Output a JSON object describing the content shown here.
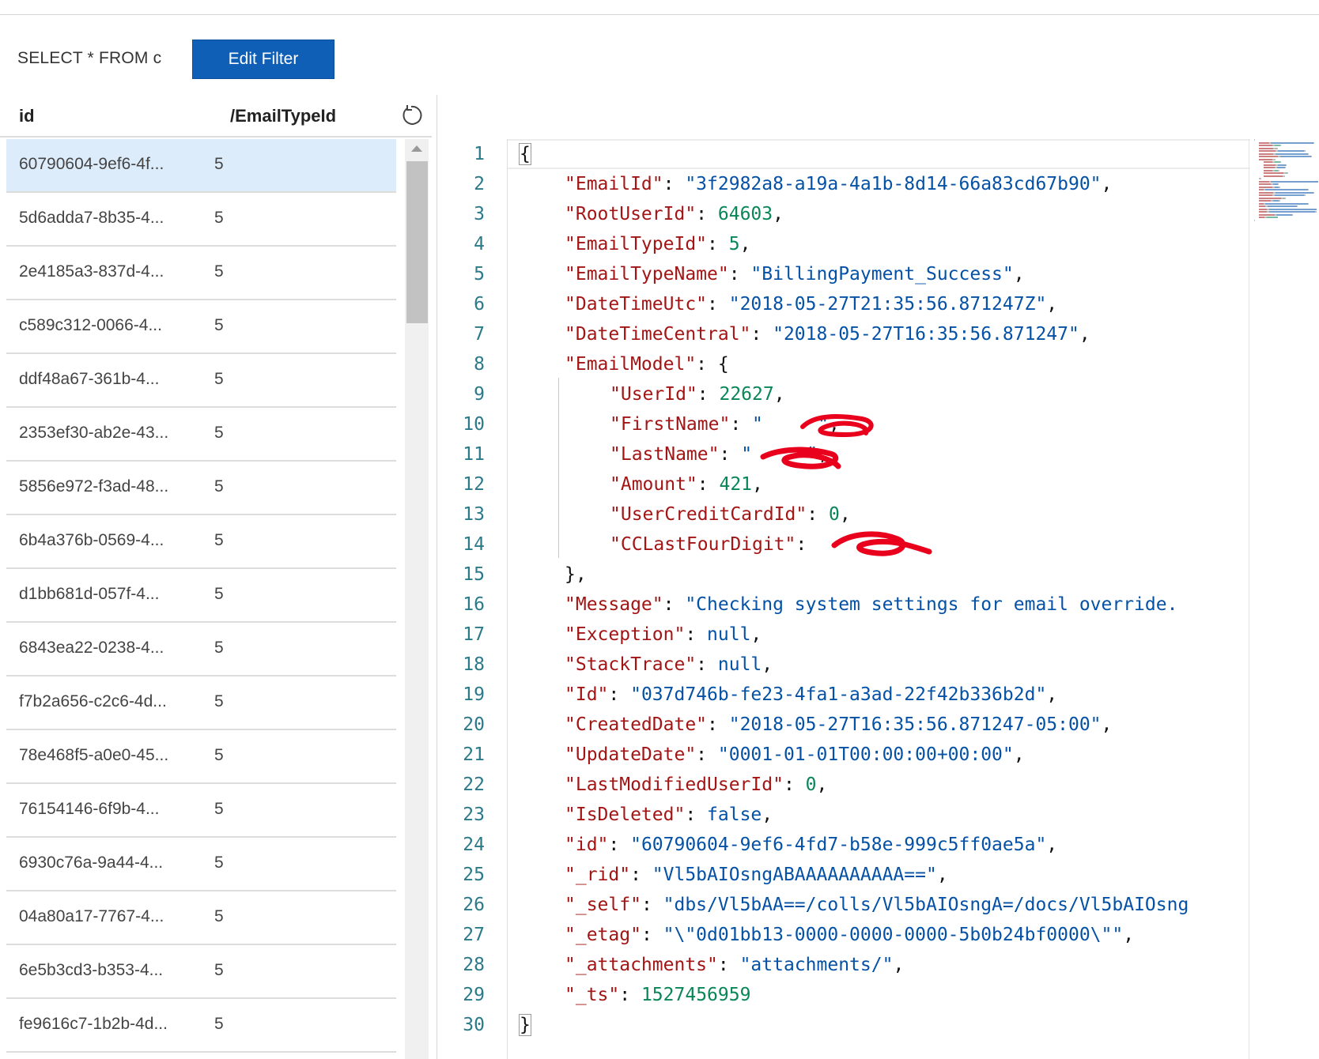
{
  "filter": {
    "query": "SELECT * FROM c",
    "edit_label": "Edit Filter"
  },
  "table": {
    "headers": {
      "id": "id",
      "partition": "/EmailTypeId"
    },
    "rows": [
      {
        "id": "60790604-9ef6-4f...",
        "value": "5",
        "selected": true
      },
      {
        "id": "5d6adda7-8b35-4...",
        "value": "5"
      },
      {
        "id": "2e4185a3-837d-4...",
        "value": "5"
      },
      {
        "id": "c589c312-0066-4...",
        "value": "5"
      },
      {
        "id": "ddf48a67-361b-4...",
        "value": "5"
      },
      {
        "id": "2353ef30-ab2e-43...",
        "value": "5"
      },
      {
        "id": "5856e972-f3ad-48...",
        "value": "5"
      },
      {
        "id": "6b4a376b-0569-4...",
        "value": "5"
      },
      {
        "id": "d1bb681d-057f-4...",
        "value": "5"
      },
      {
        "id": "6843ea22-0238-4...",
        "value": "5"
      },
      {
        "id": "f7b2a656-c2c6-4d...",
        "value": "5"
      },
      {
        "id": "78e468f5-a0e0-45...",
        "value": "5"
      },
      {
        "id": "76154146-6f9b-4...",
        "value": "5"
      },
      {
        "id": "6930c76a-9a44-4...",
        "value": "5"
      },
      {
        "id": "04a80a17-7767-4...",
        "value": "5"
      },
      {
        "id": "6e5b3cd3-b353-4...",
        "value": "5"
      },
      {
        "id": "fe9616c7-1b2b-4d...",
        "value": "5"
      }
    ]
  },
  "icons": {
    "refresh": "refresh-icon",
    "scroll_up": "scroll-up-arrow-icon"
  },
  "colors": {
    "accent": "#0f5fb7",
    "selected_row": "#ddecfb",
    "json_key": "#a31515",
    "json_string": "#0451a5",
    "json_number": "#098658",
    "redaction": "#e8001c"
  },
  "editor": {
    "lines": [
      {
        "n": "1",
        "indent": 0,
        "parts": [
          [
            "p",
            "{"
          ]
        ]
      },
      {
        "n": "2",
        "indent": 1,
        "parts": [
          [
            "k",
            "\"EmailId\""
          ],
          [
            "p",
            ": "
          ],
          [
            "s",
            "\"3f2982a8-a19a-4a1b-8d14-66a83cd67b90\""
          ],
          [
            "p",
            ","
          ]
        ]
      },
      {
        "n": "3",
        "indent": 1,
        "parts": [
          [
            "k",
            "\"RootUserId\""
          ],
          [
            "p",
            ": "
          ],
          [
            "n",
            "64603"
          ],
          [
            "p",
            ","
          ]
        ]
      },
      {
        "n": "4",
        "indent": 1,
        "parts": [
          [
            "k",
            "\"EmailTypeId\""
          ],
          [
            "p",
            ": "
          ],
          [
            "n",
            "5"
          ],
          [
            "p",
            ","
          ]
        ]
      },
      {
        "n": "5",
        "indent": 1,
        "parts": [
          [
            "k",
            "\"EmailTypeName\""
          ],
          [
            "p",
            ": "
          ],
          [
            "s",
            "\"BillingPayment_Success\""
          ],
          [
            "p",
            ","
          ]
        ]
      },
      {
        "n": "6",
        "indent": 1,
        "parts": [
          [
            "k",
            "\"DateTimeUtc\""
          ],
          [
            "p",
            ": "
          ],
          [
            "s",
            "\"2018-05-27T21:35:56.871247Z\""
          ],
          [
            "p",
            ","
          ]
        ]
      },
      {
        "n": "7",
        "indent": 1,
        "parts": [
          [
            "k",
            "\"DateTimeCentral\""
          ],
          [
            "p",
            ": "
          ],
          [
            "s",
            "\"2018-05-27T16:35:56.871247\""
          ],
          [
            "p",
            ","
          ]
        ]
      },
      {
        "n": "8",
        "indent": 1,
        "parts": [
          [
            "k",
            "\"EmailModel\""
          ],
          [
            "p",
            ": {"
          ]
        ]
      },
      {
        "n": "9",
        "indent": 2,
        "parts": [
          [
            "k",
            "\"UserId\""
          ],
          [
            "p",
            ": "
          ],
          [
            "n",
            "22627"
          ],
          [
            "p",
            ","
          ]
        ]
      },
      {
        "n": "10",
        "indent": 2,
        "parts": [
          [
            "k",
            "\"FirstName\""
          ],
          [
            "p",
            ": "
          ],
          [
            "s",
            "\"     \""
          ],
          [
            "p",
            ","
          ]
        ]
      },
      {
        "n": "11",
        "indent": 2,
        "parts": [
          [
            "k",
            "\"LastName\""
          ],
          [
            "p",
            ": "
          ],
          [
            "s",
            "\"     \""
          ],
          [
            "p",
            ","
          ]
        ]
      },
      {
        "n": "12",
        "indent": 2,
        "parts": [
          [
            "k",
            "\"Amount\""
          ],
          [
            "p",
            ": "
          ],
          [
            "n",
            "421"
          ],
          [
            "p",
            ","
          ]
        ]
      },
      {
        "n": "13",
        "indent": 2,
        "parts": [
          [
            "k",
            "\"UserCreditCardId\""
          ],
          [
            "p",
            ": "
          ],
          [
            "n",
            "0"
          ],
          [
            "p",
            ","
          ]
        ]
      },
      {
        "n": "14",
        "indent": 2,
        "parts": [
          [
            "k",
            "\"CCLastFourDigit\""
          ],
          [
            "p",
            ": "
          ]
        ]
      },
      {
        "n": "15",
        "indent": 1,
        "parts": [
          [
            "p",
            "},"
          ]
        ]
      },
      {
        "n": "16",
        "indent": 1,
        "parts": [
          [
            "k",
            "\"Message\""
          ],
          [
            "p",
            ": "
          ],
          [
            "s",
            "\"Checking system settings for email override."
          ]
        ]
      },
      {
        "n": "17",
        "indent": 1,
        "parts": [
          [
            "k",
            "\"Exception\""
          ],
          [
            "p",
            ": "
          ],
          [
            "b",
            "null"
          ],
          [
            "p",
            ","
          ]
        ]
      },
      {
        "n": "18",
        "indent": 1,
        "parts": [
          [
            "k",
            "\"StackTrace\""
          ],
          [
            "p",
            ": "
          ],
          [
            "b",
            "null"
          ],
          [
            "p",
            ","
          ]
        ]
      },
      {
        "n": "19",
        "indent": 1,
        "parts": [
          [
            "k",
            "\"Id\""
          ],
          [
            "p",
            ": "
          ],
          [
            "s",
            "\"037d746b-fe23-4fa1-a3ad-22f42b336b2d\""
          ],
          [
            "p",
            ","
          ]
        ]
      },
      {
        "n": "20",
        "indent": 1,
        "parts": [
          [
            "k",
            "\"CreatedDate\""
          ],
          [
            "p",
            ": "
          ],
          [
            "s",
            "\"2018-05-27T16:35:56.871247-05:00\""
          ],
          [
            "p",
            ","
          ]
        ]
      },
      {
        "n": "21",
        "indent": 1,
        "parts": [
          [
            "k",
            "\"UpdateDate\""
          ],
          [
            "p",
            ": "
          ],
          [
            "s",
            "\"0001-01-01T00:00:00+00:00\""
          ],
          [
            "p",
            ","
          ]
        ]
      },
      {
        "n": "22",
        "indent": 1,
        "parts": [
          [
            "k",
            "\"LastModifiedUserId\""
          ],
          [
            "p",
            ": "
          ],
          [
            "n",
            "0"
          ],
          [
            "p",
            ","
          ]
        ]
      },
      {
        "n": "23",
        "indent": 1,
        "parts": [
          [
            "k",
            "\"IsDeleted\""
          ],
          [
            "p",
            ": "
          ],
          [
            "b",
            "false"
          ],
          [
            "p",
            ","
          ]
        ]
      },
      {
        "n": "24",
        "indent": 1,
        "parts": [
          [
            "k",
            "\"id\""
          ],
          [
            "p",
            ": "
          ],
          [
            "s",
            "\"60790604-9ef6-4fd7-b58e-999c5ff0ae5a\""
          ],
          [
            "p",
            ","
          ]
        ]
      },
      {
        "n": "25",
        "indent": 1,
        "parts": [
          [
            "k",
            "\"_rid\""
          ],
          [
            "p",
            ": "
          ],
          [
            "s",
            "\"Vl5bAIOsngABAAAAAAAAAA==\""
          ],
          [
            "p",
            ","
          ]
        ]
      },
      {
        "n": "26",
        "indent": 1,
        "parts": [
          [
            "k",
            "\"_self\""
          ],
          [
            "p",
            ": "
          ],
          [
            "s",
            "\"dbs/Vl5bAA==/colls/Vl5bAIOsngA=/docs/Vl5bAIOsng"
          ]
        ]
      },
      {
        "n": "27",
        "indent": 1,
        "parts": [
          [
            "k",
            "\"_etag\""
          ],
          [
            "p",
            ": "
          ],
          [
            "s",
            "\"\\\"0d01bb13-0000-0000-0000-5b0b24bf0000\\\"\""
          ],
          [
            "p",
            ","
          ]
        ]
      },
      {
        "n": "28",
        "indent": 1,
        "parts": [
          [
            "k",
            "\"_attachments\""
          ],
          [
            "p",
            ": "
          ],
          [
            "s",
            "\"attachments/\""
          ],
          [
            "p",
            ","
          ]
        ]
      },
      {
        "n": "29",
        "indent": 1,
        "parts": [
          [
            "k",
            "\"_ts\""
          ],
          [
            "p",
            ": "
          ],
          [
            "n",
            "1527456959"
          ]
        ]
      },
      {
        "n": "30",
        "indent": 0,
        "parts": [
          [
            "p",
            "}"
          ]
        ]
      }
    ]
  }
}
